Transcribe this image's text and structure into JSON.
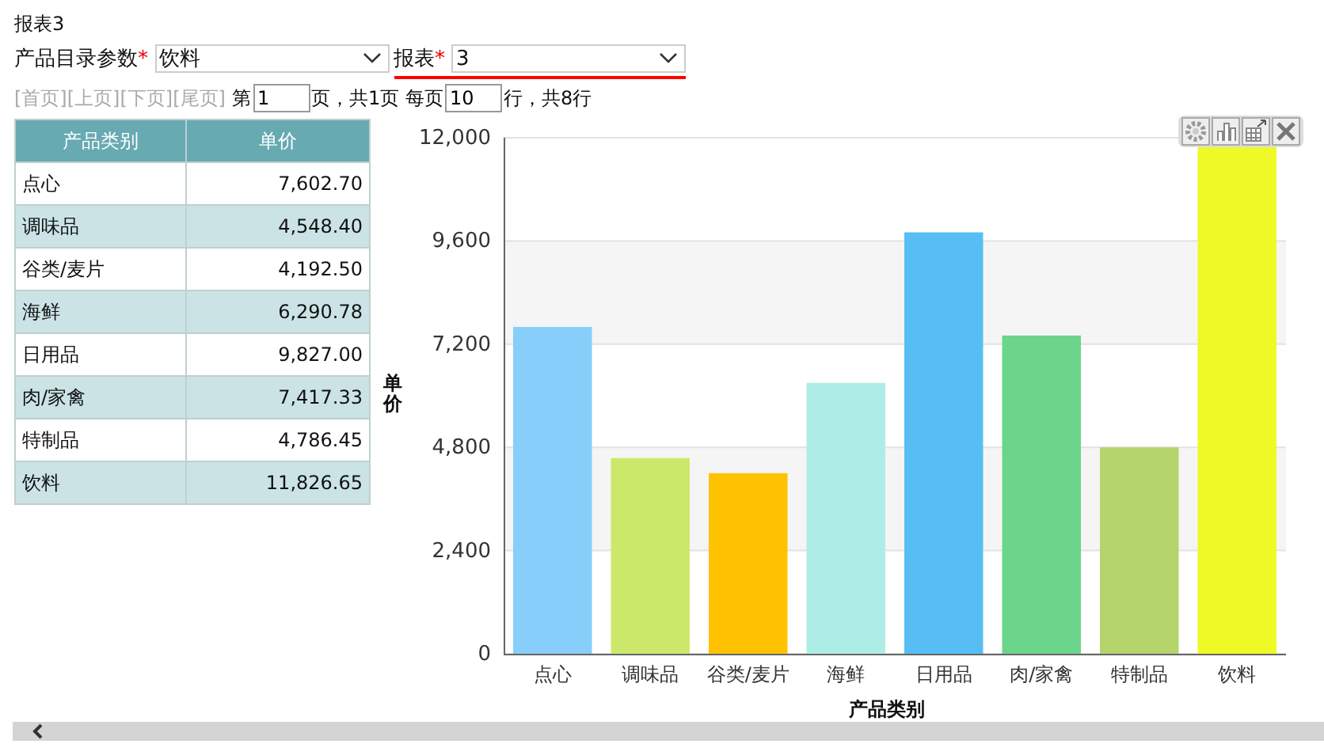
{
  "title": "报表3",
  "params": [
    {
      "label": "产品目录参数",
      "required_mark": "*",
      "value": "饮料",
      "highlighted": false
    },
    {
      "label": "报表",
      "required_mark": "*",
      "value": "3",
      "highlighted": true
    }
  ],
  "pager": {
    "links": [
      {
        "label": "[首页]",
        "disabled": true
      },
      {
        "label": "[上页]",
        "disabled": true
      },
      {
        "label": "[下页]",
        "disabled": true
      },
      {
        "label": "[尾页]",
        "disabled": true
      }
    ],
    "page_prefix": "第",
    "page": "1",
    "page_suffix": "页，共1页 每页",
    "page_size": "10",
    "size_suffix": "行，共8行"
  },
  "table": {
    "columns": [
      "产品类别",
      "单价"
    ],
    "rows": [
      [
        "点心",
        "7,602.70"
      ],
      [
        "调味品",
        "4,548.40"
      ],
      [
        "谷类/麦片",
        "4,192.50"
      ],
      [
        "海鲜",
        "6,290.78"
      ],
      [
        "日用品",
        "9,827.00"
      ],
      [
        "肉/家禽",
        "7,417.33"
      ],
      [
        "特制品",
        "4,786.45"
      ],
      [
        "饮料",
        "11,826.65"
      ]
    ]
  },
  "chart": {
    "chart_data": {
      "type": "bar",
      "xlabel": "产品类别",
      "ylabel": "单价",
      "categories": [
        "点心",
        "调味品",
        "谷类/麦片",
        "海鲜",
        "日用品",
        "肉/家禽",
        "特制品",
        "饮料"
      ],
      "series": [
        {
          "colors": [
            "#87cefa",
            "#cce86b",
            "#ffc200",
            "#aeede5",
            "#56bef5",
            "#6bd58b",
            "#b5d46c",
            "#eef925"
          ],
          "values": [
            7600,
            4550,
            4200,
            6300,
            9800,
            7400,
            4800,
            11800
          ]
        }
      ],
      "grid": true,
      "ylim": [
        0,
        12000
      ],
      "yticks": [
        {
          "value": 0,
          "label": "0"
        },
        {
          "value": 2400,
          "label": "2,400"
        },
        {
          "value": 4800,
          "label": "4,800"
        },
        {
          "value": 7200,
          "label": "7,200"
        },
        {
          "value": 9600,
          "label": "9,600"
        },
        {
          "value": 12000,
          "label": "12,000"
        }
      ]
    }
  }
}
